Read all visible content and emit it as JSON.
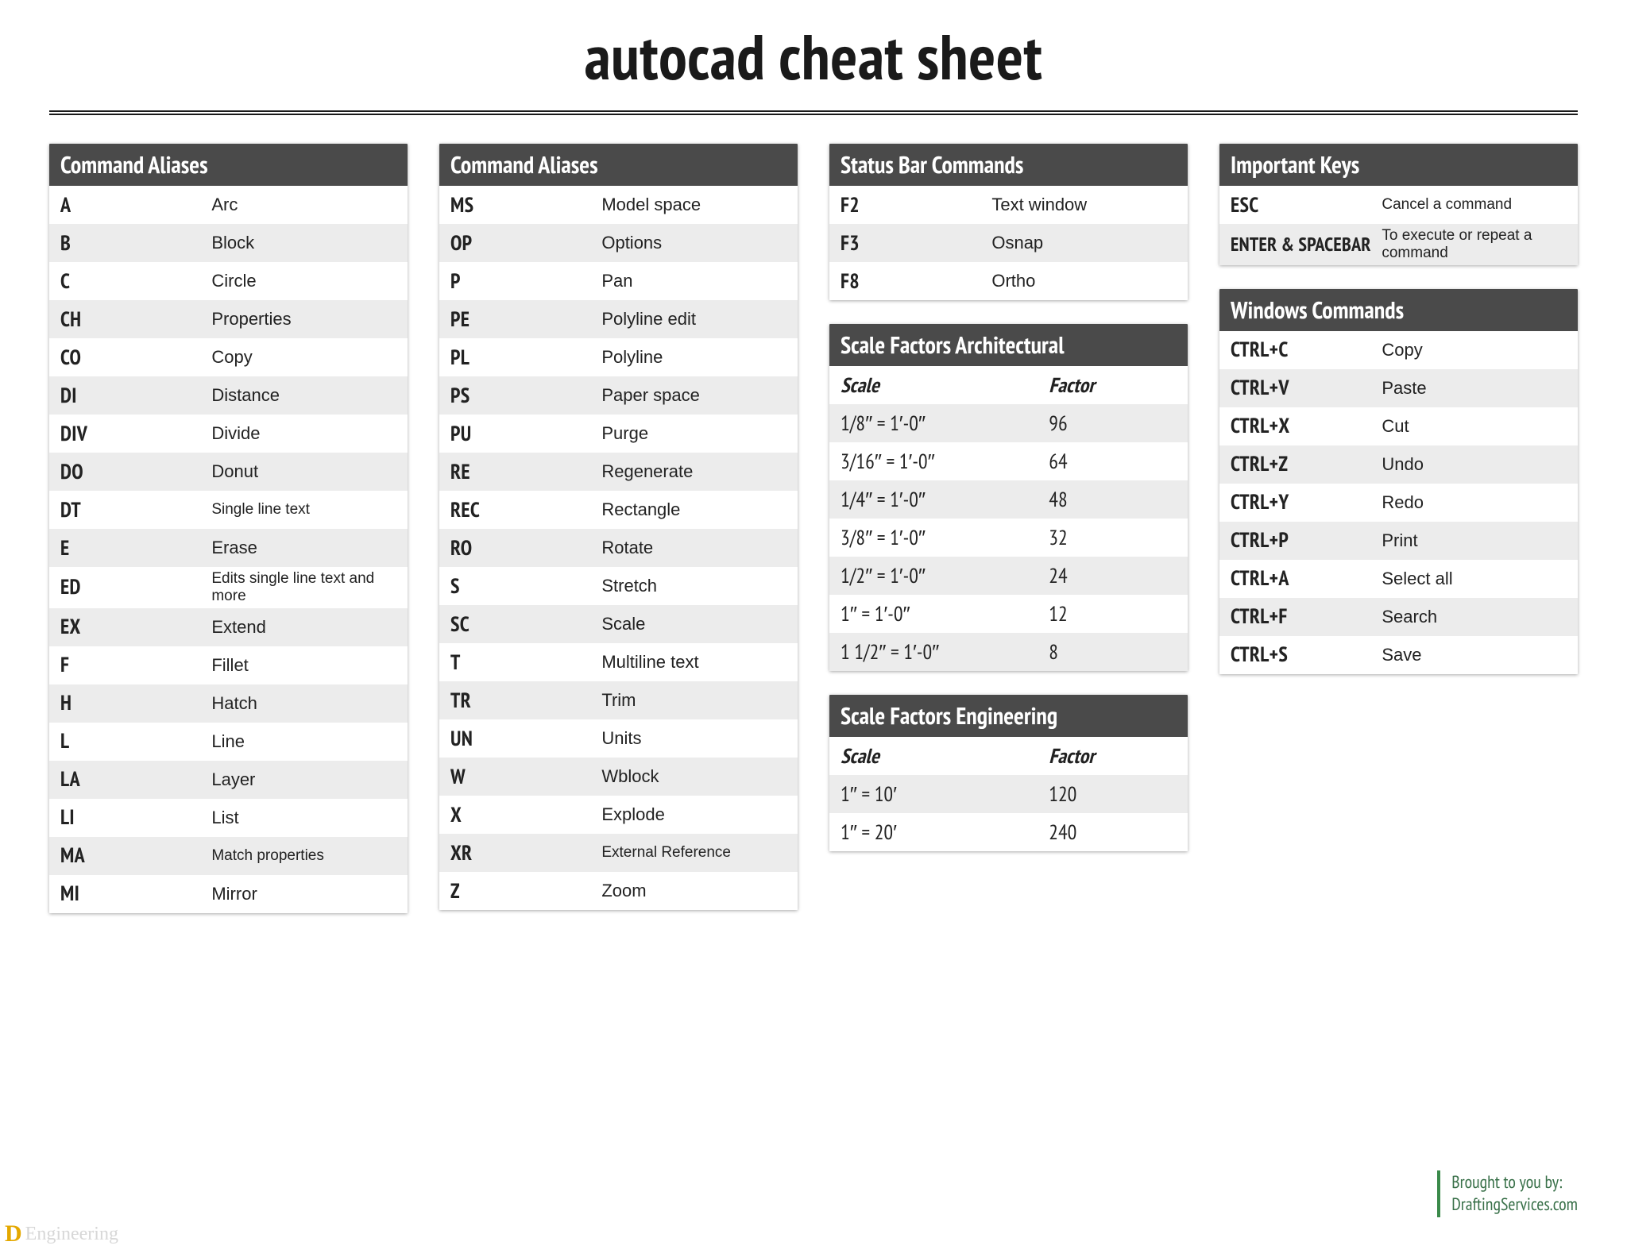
{
  "title": "autocad cheat sheet",
  "credit": {
    "line1": "Brought to you by:",
    "line2": "DraftingServices.com"
  },
  "watermark": "Engineering",
  "sections": {
    "aliases1": {
      "header": "Command Aliases",
      "rows": [
        {
          "k": "A",
          "v": "Arc"
        },
        {
          "k": "B",
          "v": "Block"
        },
        {
          "k": "C",
          "v": "Circle"
        },
        {
          "k": "CH",
          "v": "Properties"
        },
        {
          "k": "CO",
          "v": "Copy"
        },
        {
          "k": "DI",
          "v": "Distance"
        },
        {
          "k": "DIV",
          "v": "Divide"
        },
        {
          "k": "DO",
          "v": "Donut"
        },
        {
          "k": "DT",
          "v": "Single line text",
          "vsmall": true
        },
        {
          "k": "E",
          "v": "Erase"
        },
        {
          "k": "ED",
          "v": "Edits single line text and more",
          "vsmall": true
        },
        {
          "k": "EX",
          "v": "Extend"
        },
        {
          "k": "F",
          "v": "Fillet"
        },
        {
          "k": "H",
          "v": "Hatch"
        },
        {
          "k": "L",
          "v": "Line"
        },
        {
          "k": "LA",
          "v": "Layer"
        },
        {
          "k": "LI",
          "v": "List"
        },
        {
          "k": "MA",
          "v": "Match properties",
          "vsmall": true
        },
        {
          "k": "MI",
          "v": "Mirror"
        }
      ]
    },
    "aliases2": {
      "header": "Command Aliases",
      "rows": [
        {
          "k": "MS",
          "v": "Model space"
        },
        {
          "k": "OP",
          "v": "Options"
        },
        {
          "k": "P",
          "v": "Pan"
        },
        {
          "k": "PE",
          "v": "Polyline edit"
        },
        {
          "k": "PL",
          "v": "Polyline"
        },
        {
          "k": "PS",
          "v": "Paper space"
        },
        {
          "k": "PU",
          "v": "Purge"
        },
        {
          "k": "RE",
          "v": "Regenerate"
        },
        {
          "k": "REC",
          "v": "Rectangle"
        },
        {
          "k": "RO",
          "v": "Rotate"
        },
        {
          "k": "S",
          "v": "Stretch"
        },
        {
          "k": "SC",
          "v": "Scale"
        },
        {
          "k": "T",
          "v": "Multiline text"
        },
        {
          "k": "TR",
          "v": "Trim"
        },
        {
          "k": "UN",
          "v": "Units"
        },
        {
          "k": "W",
          "v": "Wblock"
        },
        {
          "k": "X",
          "v": "Explode"
        },
        {
          "k": "XR",
          "v": "External Reference",
          "vsmall": true
        },
        {
          "k": "Z",
          "v": "Zoom"
        }
      ]
    },
    "status": {
      "header": "Status Bar Commands",
      "rows": [
        {
          "k": "F2",
          "v": "Text window"
        },
        {
          "k": "F3",
          "v": "Osnap"
        },
        {
          "k": "F8",
          "v": "Ortho"
        }
      ]
    },
    "scaleArch": {
      "header": "Scale Factors Architectural",
      "subhead": {
        "k": "Scale",
        "v": "Factor"
      },
      "rows": [
        {
          "k": "1/8″ = 1′-0″",
          "v": "96"
        },
        {
          "k": "3/16″ = 1′-0″",
          "v": "64"
        },
        {
          "k": "1/4″ = 1′-0″",
          "v": "48"
        },
        {
          "k": "3/8″ = 1′-0″",
          "v": "32"
        },
        {
          "k": "1/2″ = 1′-0″",
          "v": "24"
        },
        {
          "k": "1″ = 1′-0″",
          "v": "12"
        },
        {
          "k": "1 1/2″ = 1′-0″",
          "v": "8"
        }
      ]
    },
    "scaleEng": {
      "header": "Scale Factors Engineering",
      "subhead": {
        "k": "Scale",
        "v": "Factor"
      },
      "rows": [
        {
          "k": "1″ = 10′",
          "v": "120"
        },
        {
          "k": "1″ = 20′",
          "v": "240"
        }
      ]
    },
    "important": {
      "header": "Important Keys",
      "rows": [
        {
          "k": "ESC",
          "v": "Cancel a command",
          "vsmall": true
        },
        {
          "k": "ENTER & SPACEBAR",
          "v": "To execute or repeat a command",
          "ksmall": true,
          "vsmall": true
        }
      ]
    },
    "windows": {
      "header": "Windows Commands",
      "rows": [
        {
          "k": "CTRL+C",
          "v": "Copy"
        },
        {
          "k": "CTRL+V",
          "v": "Paste"
        },
        {
          "k": "CTRL+X",
          "v": "Cut"
        },
        {
          "k": "CTRL+Z",
          "v": "Undo"
        },
        {
          "k": "CTRL+Y",
          "v": "Redo"
        },
        {
          "k": "CTRL+P",
          "v": "Print"
        },
        {
          "k": "CTRL+A",
          "v": "Select all"
        },
        {
          "k": "CTRL+F",
          "v": "Search"
        },
        {
          "k": "CTRL+S",
          "v": "Save"
        }
      ]
    }
  }
}
